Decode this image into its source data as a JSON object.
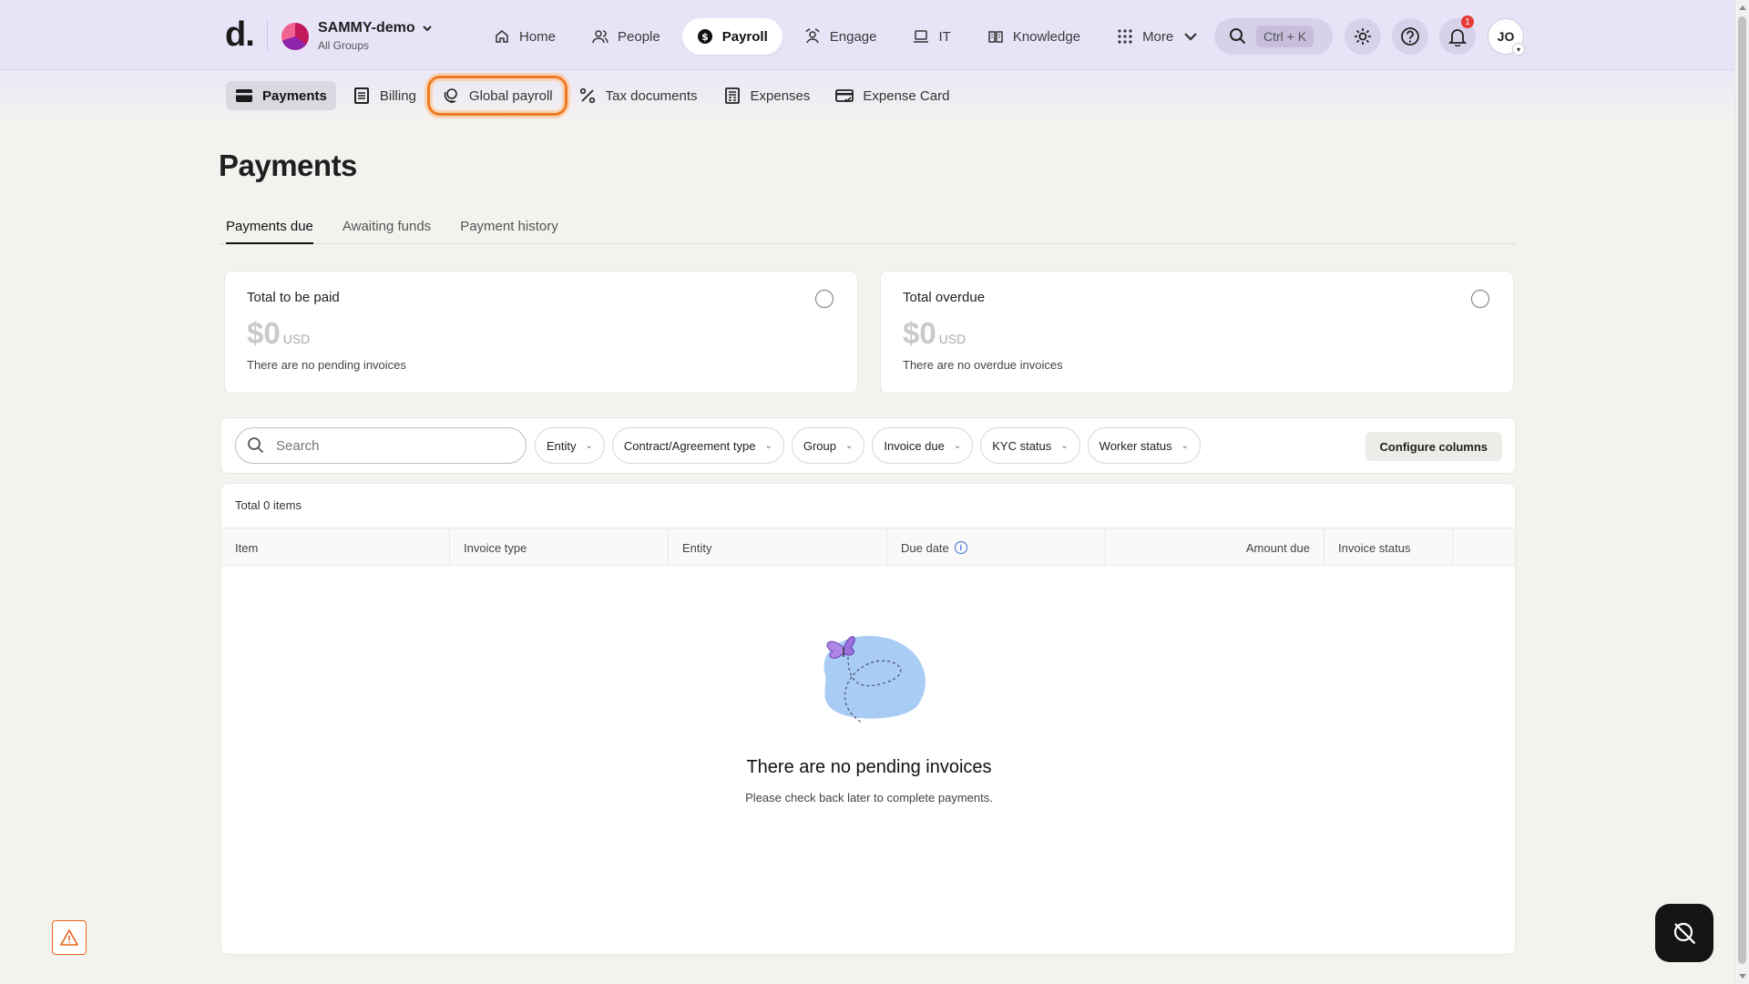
{
  "header": {
    "logo": "d.",
    "org": {
      "name": "SAMMY-demo",
      "subtitle": "All Groups"
    },
    "nav": [
      {
        "label": "Home",
        "icon": "home-icon"
      },
      {
        "label": "People",
        "icon": "people-icon"
      },
      {
        "label": "Payroll",
        "icon": "dollar-icon",
        "active": true
      },
      {
        "label": "Engage",
        "icon": "engage-icon"
      },
      {
        "label": "IT",
        "icon": "laptop-icon"
      },
      {
        "label": "Knowledge",
        "icon": "book-icon"
      },
      {
        "label": "More",
        "icon": "grid-icon"
      }
    ],
    "search_shortcut": "Ctrl + K",
    "notification_count": "1",
    "user_initials": "JO"
  },
  "subnav": [
    {
      "label": "Payments",
      "icon": "wallet-icon",
      "active": true
    },
    {
      "label": "Billing",
      "icon": "receipt-icon"
    },
    {
      "label": "Global payroll",
      "icon": "globe-icon",
      "focused": true
    },
    {
      "label": "Tax documents",
      "icon": "percent-icon"
    },
    {
      "label": "Expenses",
      "icon": "expenses-icon"
    },
    {
      "label": "Expense Card",
      "icon": "card-icon"
    }
  ],
  "page": {
    "title": "Payments",
    "tabs": [
      "Payments due",
      "Awaiting funds",
      "Payment history"
    ]
  },
  "cards": [
    {
      "title": "Total to be paid",
      "amount": "$0",
      "currency": "USD",
      "note": "There are no pending invoices"
    },
    {
      "title": "Total overdue",
      "amount": "$0",
      "currency": "USD",
      "note": "There are no overdue invoices"
    }
  ],
  "filters": {
    "search_placeholder": "Search",
    "chips": [
      "Entity",
      "Contract/Agreement type",
      "Group",
      "Invoice due",
      "KYC status",
      "Worker status"
    ],
    "configure_label": "Configure columns"
  },
  "table": {
    "total_label": "Total 0 items",
    "columns": [
      "Item",
      "Invoice type",
      "Entity",
      "Due date",
      "Amount due",
      "Invoice status"
    ],
    "empty_title": "There are no pending invoices",
    "empty_subtitle": "Please check back later to complete payments."
  },
  "colors": {
    "topbar": "#e9e3f8",
    "accent_focus": "#f07a22",
    "badge": "#e53935"
  }
}
